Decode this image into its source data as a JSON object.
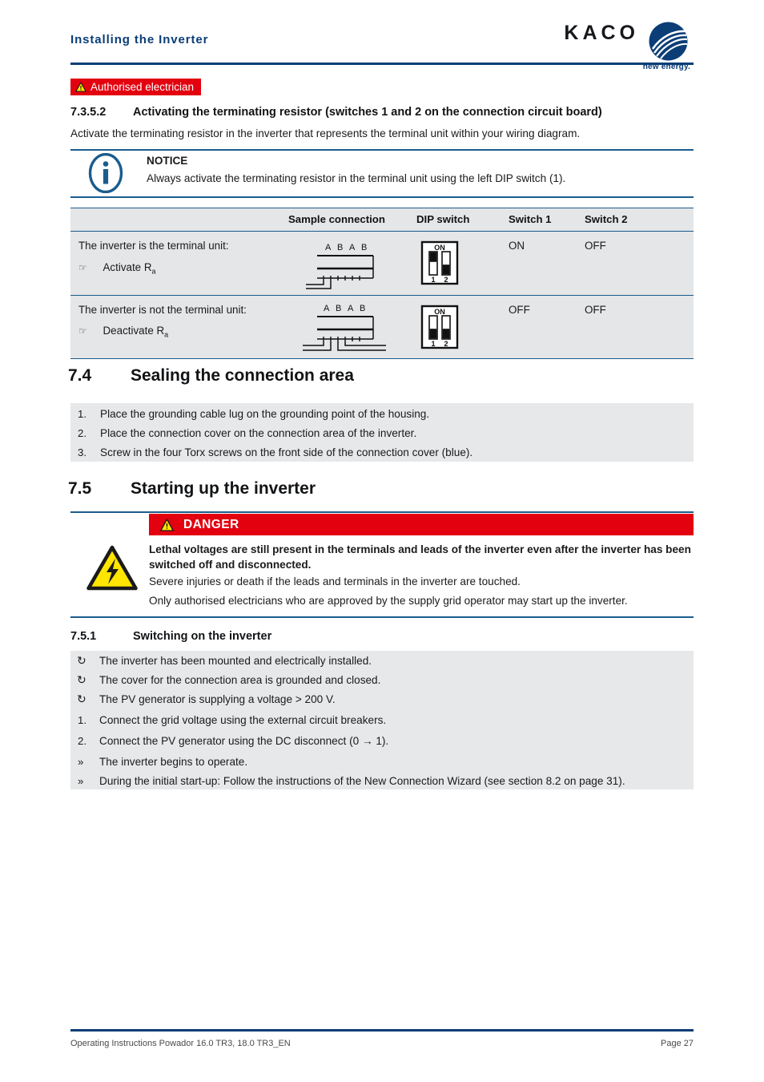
{
  "header": {
    "title": "Installing the Inverter",
    "logo_text": "KACO",
    "logo_tagline": "new energy."
  },
  "badge": {
    "label": "Authorised electrician",
    "bg_color": "#e3000f"
  },
  "section_7352": {
    "number": "7.3.5.2",
    "title": "Activating the terminating resistor (switches 1 and 2 on the connection circuit board)",
    "intro": "Activate the terminating resistor in the inverter that represents the terminal unit within your wiring diagram."
  },
  "notice": {
    "title": "NOTICE",
    "text": "Always activate the terminating resistor in the terminal unit using the left DIP switch (1).",
    "icon": "info-icon"
  },
  "table": {
    "headers": [
      "",
      "Sample connection",
      "DIP switch",
      "Switch 1",
      "Switch 2"
    ],
    "rows": [
      {
        "desc": "The inverter is the terminal unit:",
        "action": "Activate R",
        "action_sub": "a",
        "diagram_labels": "A B A B",
        "dip_on_label": "ON",
        "dip_positions": [
          "up",
          "down"
        ],
        "dip_numbers": [
          "1",
          "2"
        ],
        "switch1": "ON",
        "switch2": "OFF"
      },
      {
        "desc": "The inverter is not the terminal unit:",
        "action": "Deactivate R",
        "action_sub": "a",
        "diagram_labels": "A B A B",
        "dip_on_label": "ON",
        "dip_positions": [
          "down",
          "down"
        ],
        "dip_numbers": [
          "1",
          "2"
        ],
        "switch1": "OFF",
        "switch2": "OFF"
      }
    ]
  },
  "section_74": {
    "number": "7.4",
    "title": "Sealing the connection area",
    "steps": [
      {
        "marker": "1.",
        "text": "Place the grounding cable lug on the grounding point of the housing."
      },
      {
        "marker": "2.",
        "text": "Place the connection cover on the connection area of the inverter."
      },
      {
        "marker": "3.",
        "text": "Screw in the four Torx screws on the front side of the connection cover (blue)."
      }
    ]
  },
  "section_75": {
    "number": "7.5",
    "title": "Starting up the inverter"
  },
  "danger": {
    "label": "DANGER",
    "bold_text": "Lethal voltages are still present in the terminals and leads of the inverter even after the inverter has been switched off and disconnected.",
    "line1": "Severe injuries or death if the leads and terminals in the inverter are touched.",
    "line2": "Only authorised electricians who are approved by the supply grid operator may start up the inverter.",
    "icon": "electric-shock-warning-icon"
  },
  "section_751": {
    "number": "7.5.1",
    "title": "Switching on the inverter",
    "items": [
      {
        "marker": "↻",
        "text": "The inverter has been mounted and electrically installed."
      },
      {
        "marker": "↻",
        "text": "The cover for the connection area is grounded and closed."
      },
      {
        "marker": "↻",
        "text": "The PV generator is supplying a voltage > 200 V."
      },
      {
        "marker": "1.",
        "text": "Connect the grid voltage using the external circuit breakers."
      },
      {
        "marker": "2.",
        "text": "Connect the PV generator using the DC disconnect (0 → 1)."
      },
      {
        "marker": "»",
        "text": "The inverter begins to operate."
      },
      {
        "marker": "»",
        "text": "During the initial start-up: Follow the instructions of the New Connection Wizard (see section 8.2 on page 31)."
      }
    ]
  },
  "footer": {
    "left": "Operating Instructions Powador 16.0 TR3, 18.0 TR3_EN",
    "right": "Page 27"
  },
  "colors": {
    "brand_blue": "#0b3d76",
    "rule_blue": "#1a5c8e",
    "danger_red": "#e3000f",
    "warn_yellow": "#ffe500",
    "gray_block": "#e7e8ea"
  }
}
